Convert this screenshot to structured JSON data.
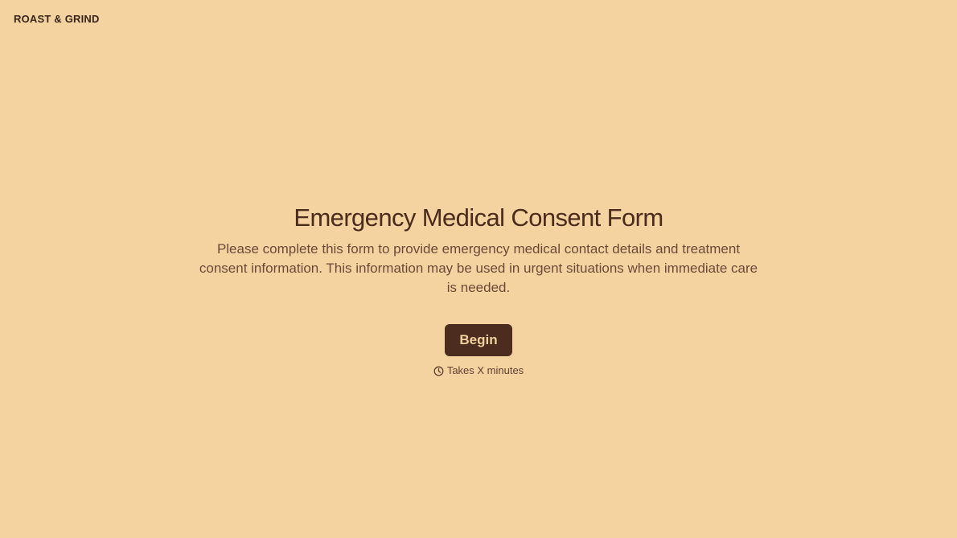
{
  "brand": {
    "name": "ROAST & GRIND"
  },
  "hero": {
    "title": "Emergency Medical Consent Form",
    "description": "Please complete this form to provide emergency medical contact details and treatment consent information. This information may be used in urgent situations when immediate care is needed.",
    "button_label": "Begin",
    "duration_text": "Takes X minutes",
    "duration_icon": "clock-icon"
  },
  "colors": {
    "background": "#f4d3a1",
    "primary_text": "#4a2b1c",
    "button_background": "#4b2c1e",
    "button_text": "#f1d29e"
  }
}
